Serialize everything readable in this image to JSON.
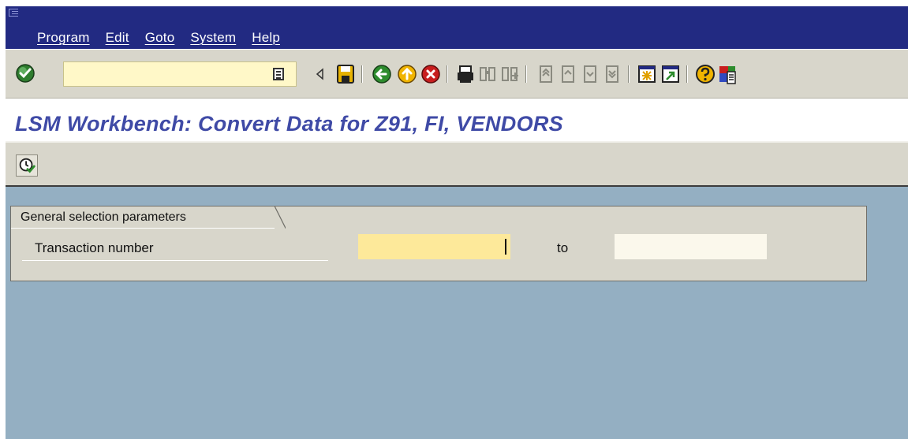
{
  "menubar": {
    "items": [
      "Program",
      "Edit",
      "Goto",
      "System",
      "Help"
    ]
  },
  "toolbar": {
    "command_field_value": "",
    "icons": [
      "enter-icon",
      "command-field-menu-icon",
      "back-arrow-icon",
      "save-icon",
      "back-icon",
      "exit-icon",
      "cancel-icon",
      "print-icon",
      "find-icon",
      "find-next-icon",
      "first-page-icon",
      "previous-page-icon",
      "next-page-icon",
      "last-page-icon",
      "create-session-icon",
      "shortcut-icon",
      "help-icon",
      "layout-menu-icon"
    ]
  },
  "title": {
    "text": "LSM Workbench: Convert Data for Z91, FI, VENDORS"
  },
  "apptoolbar": {
    "execute_icon": "execute-icon"
  },
  "selection": {
    "group_title": "General selection parameters",
    "row_label": "Transaction number",
    "from_value": "",
    "to_label": "to",
    "to_value": ""
  },
  "colors": {
    "menubar_bg": "#222a82",
    "toolbar_bg": "#d8d6cb",
    "title_color": "#3f4aa6",
    "content_bg": "#94afc2",
    "required_field_bg": "#fde99a"
  }
}
